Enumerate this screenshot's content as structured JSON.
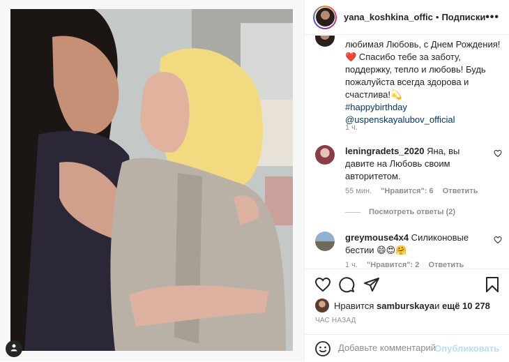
{
  "header": {
    "username": "yana_koshkina_offic",
    "separator": "•",
    "follow_label": "Подписки",
    "more_label": "•••"
  },
  "caption": {
    "line1": "любимая Любовь, с Днем Рождения!",
    "heart": "❤️",
    "line2": " Спасибо тебе за заботу, поддержку, тепло и любовь! Будь пожалуйста всегда здорова и счастлива!",
    "emoji": "💫",
    "hashtag": "#happybirthday",
    "mention": "@uspenskayalubov_official",
    "timestamp": "1 ч."
  },
  "comments": [
    {
      "username": "leningradets_2020",
      "text": " Яна, вы давите на Любовь своим авторитетом.",
      "time": "55 мин.",
      "likes": "\"Нравится\": 6",
      "reply": "Ответить",
      "view_replies": "Посмотреть ответы (2)"
    },
    {
      "username": "greymouse4x4",
      "text": " Силиконовые бестии 😄😍🤗",
      "time": "1 ч.",
      "likes": "\"Нравится\": 2",
      "reply": "Ответить"
    }
  ],
  "likes": {
    "prefix": "Нравится ",
    "user": "samburskaya",
    "middle": " и ",
    "count": "ещё 10 278"
  },
  "time_ago": "ЧАС НАЗАД",
  "comment_input": {
    "placeholder": "Добавьте комментарий..."
  },
  "publish_label": "Опубликовать",
  "icons": {
    "like": "heart-icon",
    "comment": "comment-icon",
    "share": "paper-plane-icon",
    "save": "bookmark-icon",
    "emoji": "smiley-icon",
    "tag": "user-tag-icon"
  }
}
